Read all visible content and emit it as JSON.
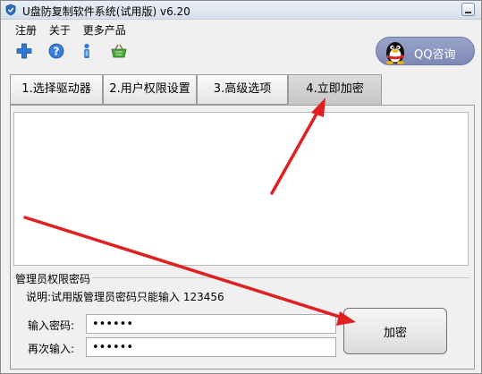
{
  "window": {
    "title": "U盘防复制软件系统(试用版) v6.20"
  },
  "menu": {
    "items": [
      "注册",
      "关于",
      "更多产品"
    ]
  },
  "toolbar": {
    "icons": [
      "plus-icon",
      "help-icon",
      "info-icon",
      "basket-icon"
    ]
  },
  "qq": {
    "label": "QQ咨询"
  },
  "tabs": [
    {
      "label": "1.选择驱动器"
    },
    {
      "label": "2.用户权限设置"
    },
    {
      "label": "3.高级选项"
    },
    {
      "label": "4.立即加密"
    }
  ],
  "active_tab": 3,
  "password_group": {
    "title": "管理员权限密码",
    "hint": "说明:试用版管理员密码只能输入 123456",
    "input_label": "输入密码:",
    "confirm_label": "再次输入:",
    "password_value": "123456",
    "confirm_value": "123456"
  },
  "actions": {
    "encrypt_label": "加密"
  },
  "colors": {
    "annotation_arrow": "#e02020",
    "qq_button": "#8891bd"
  }
}
